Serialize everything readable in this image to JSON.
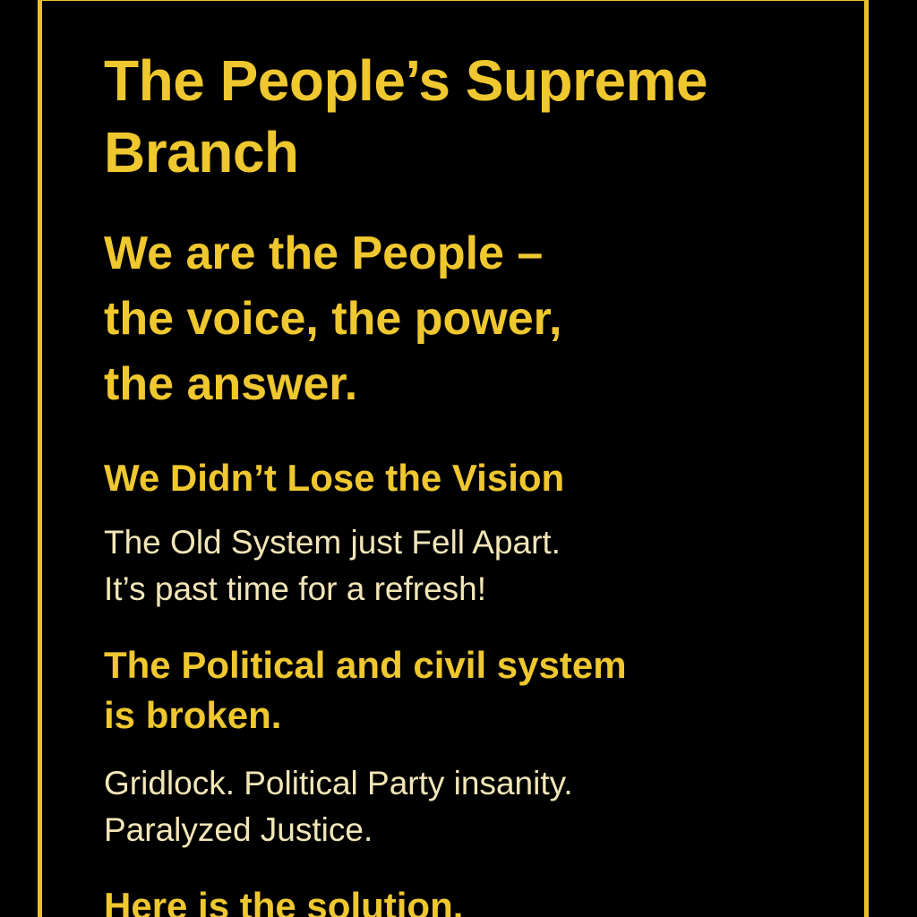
{
  "title": [
    "The People’s Supreme",
    "Branch"
  ],
  "tagline": [
    "We are the People –",
    "the voice, the power,",
    "the answer."
  ],
  "section1": {
    "heading": "We Didn’t Lose the Vision",
    "body": [
      "The Old System just Fell Apart.",
      "It’s past time for a refresh!"
    ]
  },
  "section2": {
    "heading": [
      "The Political and civil system",
      "is broken."
    ],
    "body": [
      "Gridlock. Political Party insanity.",
      "Paralyzed Justice."
    ]
  },
  "section3": {
    "heading": "Here is the solution."
  },
  "colors": {
    "background": "#000000",
    "accent": "#efc72f",
    "body_text": "#f2e6b8",
    "border": "#e9c02a"
  }
}
